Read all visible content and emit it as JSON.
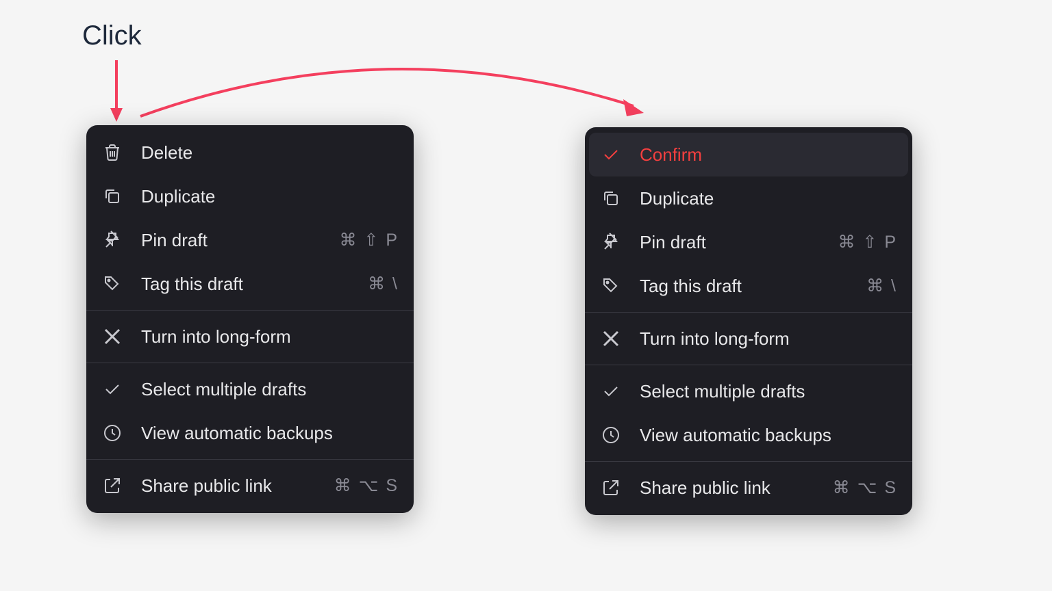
{
  "annotation": {
    "label": "Click"
  },
  "colors": {
    "accent_red": "#f43f3f",
    "menu_bg": "#1e1e24",
    "text": "#e8e8ea",
    "shortcut": "#8a8a94"
  },
  "menu_before": {
    "items": [
      {
        "icon": "trash-icon",
        "label": "Delete",
        "shortcut": ""
      },
      {
        "icon": "copy-icon",
        "label": "Duplicate",
        "shortcut": ""
      },
      {
        "icon": "pin-icon",
        "label": "Pin draft",
        "shortcut": "⌘ ⇧ P"
      },
      {
        "icon": "tag-icon",
        "label": "Tag this draft",
        "shortcut": "⌘ \\"
      },
      {
        "divider": true
      },
      {
        "icon": "x-logo-icon",
        "label": "Turn into long-form",
        "shortcut": ""
      },
      {
        "divider": true
      },
      {
        "icon": "check-icon",
        "label": "Select multiple drafts",
        "shortcut": ""
      },
      {
        "icon": "clock-icon",
        "label": "View automatic backups",
        "shortcut": ""
      },
      {
        "divider": true
      },
      {
        "icon": "external-link-icon",
        "label": "Share public link",
        "shortcut": "⌘ ⌥ S"
      }
    ]
  },
  "menu_after": {
    "items": [
      {
        "icon": "check-icon",
        "label": "Confirm",
        "shortcut": "",
        "highlighted": true
      },
      {
        "icon": "copy-icon",
        "label": "Duplicate",
        "shortcut": ""
      },
      {
        "icon": "pin-icon",
        "label": "Pin draft",
        "shortcut": "⌘ ⇧ P"
      },
      {
        "icon": "tag-icon",
        "label": "Tag this draft",
        "shortcut": "⌘ \\"
      },
      {
        "divider": true
      },
      {
        "icon": "x-logo-icon",
        "label": "Turn into long-form",
        "shortcut": ""
      },
      {
        "divider": true
      },
      {
        "icon": "check-icon",
        "label": "Select multiple drafts",
        "shortcut": ""
      },
      {
        "icon": "clock-icon",
        "label": "View automatic backups",
        "shortcut": ""
      },
      {
        "divider": true
      },
      {
        "icon": "external-link-icon",
        "label": "Share public link",
        "shortcut": "⌘ ⌥ S"
      }
    ]
  }
}
